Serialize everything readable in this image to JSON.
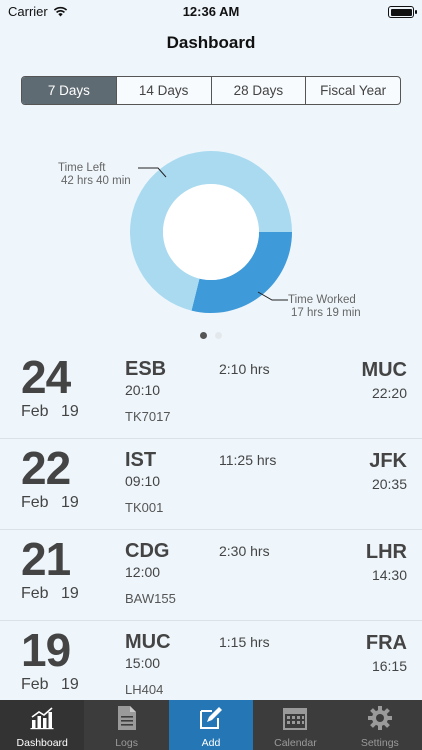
{
  "status_bar": {
    "carrier": "Carrier",
    "time": "12:36 AM"
  },
  "nav": {
    "title": "Dashboard"
  },
  "segments": [
    {
      "label": "7 Days",
      "active": true
    },
    {
      "label": "14 Days",
      "active": false
    },
    {
      "label": "28 Days",
      "active": false
    },
    {
      "label": "Fiscal Year",
      "active": false
    }
  ],
  "chart": {
    "time_left_label": "Time Left",
    "time_left_value": "42 hrs 40 min",
    "time_worked_label": "Time Worked",
    "time_worked_value": "17 hrs 19 min",
    "colors": {
      "left": "#a9daf0",
      "worked": "#3e9ad8"
    }
  },
  "chart_data": {
    "type": "pie",
    "categories": [
      "Time Left",
      "Time Worked"
    ],
    "values": [
      42.667,
      17.317
    ]
  },
  "page_dots": {
    "count": 2,
    "active": 0
  },
  "flights": [
    {
      "day": "24",
      "month": "Feb",
      "year": "19",
      "origin": "ESB",
      "dep": "20:10",
      "flight": "TK7017",
      "duration": "2:10 hrs",
      "dest": "MUC",
      "arr": "22:20"
    },
    {
      "day": "22",
      "month": "Feb",
      "year": "19",
      "origin": "IST",
      "dep": "09:10",
      "flight": "TK001",
      "duration": "11:25 hrs",
      "dest": "JFK",
      "arr": "20:35"
    },
    {
      "day": "21",
      "month": "Feb",
      "year": "19",
      "origin": "CDG",
      "dep": "12:00",
      "flight": "BAW155",
      "duration": "2:30 hrs",
      "dest": "LHR",
      "arr": "14:30"
    },
    {
      "day": "19",
      "month": "Feb",
      "year": "19",
      "origin": "MUC",
      "dep": "15:00",
      "flight": "LH404",
      "duration": "1:15 hrs",
      "dest": "FRA",
      "arr": "16:15"
    }
  ],
  "tabs": [
    {
      "label": "Dashboard",
      "icon": "bar-chart-icon"
    },
    {
      "label": "Logs",
      "icon": "document-icon"
    },
    {
      "label": "Add",
      "icon": "edit-icon"
    },
    {
      "label": "Calendar",
      "icon": "calendar-icon"
    },
    {
      "label": "Settings",
      "icon": "gear-icon"
    }
  ]
}
